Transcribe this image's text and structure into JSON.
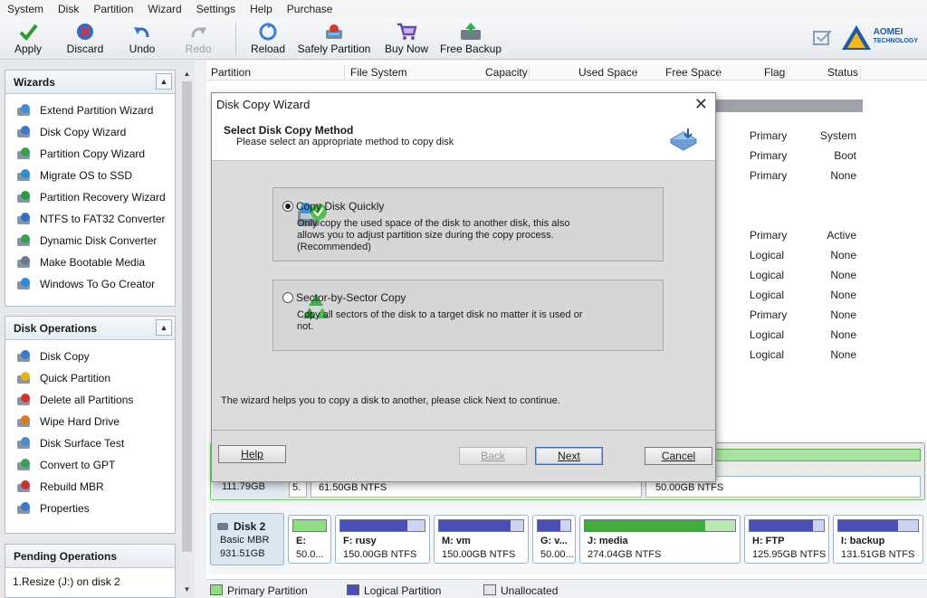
{
  "menu": [
    "System",
    "Disk",
    "Partition",
    "Wizard",
    "Settings",
    "Help",
    "Purchase"
  ],
  "toolbar": {
    "apply": "Apply",
    "discard": "Discard",
    "undo": "Undo",
    "redo": "Redo",
    "reload": "Reload",
    "safely_partition": "Safely Partition",
    "buy_now": "Buy Now",
    "free_backup": "Free Backup"
  },
  "brand": {
    "line1": "AOMEI",
    "line2": "TECHNOLOGY"
  },
  "wizards": {
    "title": "Wizards",
    "items": [
      {
        "label": "Extend Partition Wizard",
        "icon": "extend-icon"
      },
      {
        "label": "Disk Copy Wizard",
        "icon": "disk-copy-icon"
      },
      {
        "label": "Partition Copy Wizard",
        "icon": "partition-copy-icon"
      },
      {
        "label": "Migrate OS to SSD",
        "icon": "migrate-icon"
      },
      {
        "label": "Partition Recovery Wizard",
        "icon": "recovery-icon"
      },
      {
        "label": "NTFS to FAT32 Converter",
        "icon": "convert-icon"
      },
      {
        "label": "Dynamic Disk Converter",
        "icon": "dynamic-disk-icon"
      },
      {
        "label": "Make Bootable Media",
        "icon": "bootable-media-icon"
      },
      {
        "label": "Windows To Go Creator",
        "icon": "windows-icon"
      }
    ]
  },
  "disk_ops": {
    "title": "Disk Operations",
    "items": [
      {
        "label": "Disk Copy",
        "icon": "disk-copy-icon"
      },
      {
        "label": "Quick Partition",
        "icon": "lightning-icon"
      },
      {
        "label": "Delete all Partitions",
        "icon": "delete-icon"
      },
      {
        "label": "Wipe Hard Drive",
        "icon": "wipe-icon"
      },
      {
        "label": "Disk Surface Test",
        "icon": "surface-test-icon"
      },
      {
        "label": "Convert to GPT",
        "icon": "convert-gpt-icon"
      },
      {
        "label": "Rebuild MBR",
        "icon": "rebuild-icon"
      },
      {
        "label": "Properties",
        "icon": "properties-icon"
      }
    ]
  },
  "pending": {
    "title": "Pending Operations",
    "items": [
      "1.Resize (J:) on disk 2"
    ]
  },
  "table": {
    "headers": [
      "Partition",
      "File System",
      "Capacity",
      "Used Space",
      "Free Space",
      "Flag",
      "Status"
    ],
    "rows": [
      {
        "flag": "Primary",
        "status": "System"
      },
      {
        "flag": "Primary",
        "status": "Boot"
      },
      {
        "flag": "Primary",
        "status": "None"
      },
      {
        "flag": "Primary",
        "status": "Active"
      },
      {
        "flag": "Logical",
        "status": "None"
      },
      {
        "flag": "Logical",
        "status": "None"
      },
      {
        "flag": "Logical",
        "status": "None"
      },
      {
        "flag": "Primary",
        "status": "None"
      },
      {
        "flag": "Logical",
        "status": "None"
      },
      {
        "flag": "Logical",
        "status": "None"
      }
    ]
  },
  "disk1_partial": {
    "size": "111.79GB",
    "p2": "5.",
    "p3": "61.50GB NTFS",
    "p4": "50.00GB NTFS"
  },
  "disk2": {
    "name": "Disk 2",
    "type": "Basic MBR",
    "size": "931.51GB",
    "partitions": [
      {
        "label": "E:",
        "info": "50.0...",
        "fill": 1.0,
        "color": "#8fdc84"
      },
      {
        "label": "F: rusy",
        "info": "150.00GB NTFS",
        "fill": 0.8,
        "color": "#4a4fb8"
      },
      {
        "label": "M: vm",
        "info": "150.00GB NTFS",
        "fill": 0.85,
        "color": "#4a4fb8"
      },
      {
        "label": "G: v...",
        "info": "50.00...",
        "fill": 0.7,
        "color": "#4a4fb8"
      },
      {
        "label": "J: media",
        "info": "274.04GB NTFS",
        "fill": 0.8,
        "color": "#3fae3a"
      },
      {
        "label": "H: FTP",
        "info": "125.95GB NTFS",
        "fill": 0.85,
        "color": "#4a4fb8"
      },
      {
        "label": "I: backup",
        "info": "131.51GB NTFS",
        "fill": 0.75,
        "color": "#4a4fb8"
      }
    ]
  },
  "legend": {
    "primary": "Primary Partition",
    "logical": "Logical Partition",
    "unallocated": "Unallocated"
  },
  "dialog": {
    "title": "Disk Copy Wizard",
    "heading": "Select Disk Copy Method",
    "subheading": "Please select an appropriate method to copy disk",
    "option1_title": "Copy Disk Quickly",
    "option1_desc": "Only copy the used space of the disk to another disk, this also allows you to adjust partition size during the copy process.(Recommended)",
    "option2_title": "Sector-by-Sector Copy",
    "option2_desc": "Copy all sectors of the disk to a target disk no matter it is used or not.",
    "info": "The wizard helps you to copy a disk to another, please click Next to continue.",
    "help": "Help",
    "back": "Back",
    "next": "Next",
    "cancel": "Cancel"
  }
}
